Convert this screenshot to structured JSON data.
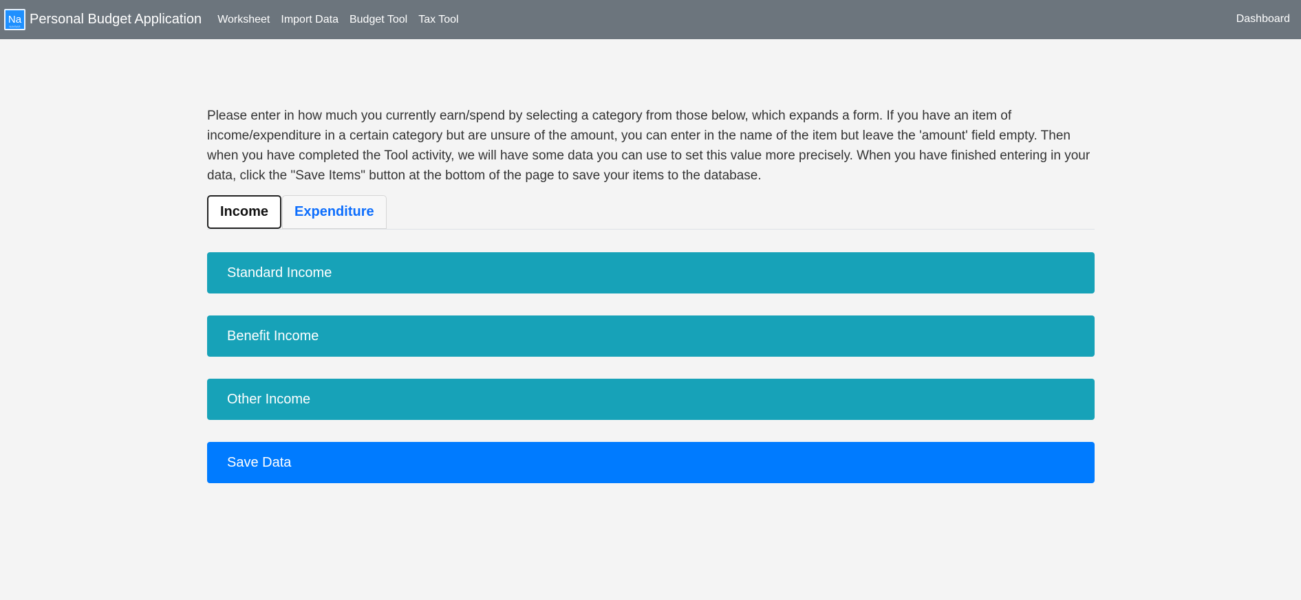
{
  "navbar": {
    "logo_text": "Na",
    "logo_subtext": "NAVBAR",
    "brand": "Personal Budget Application",
    "links": [
      "Worksheet",
      "Import Data",
      "Budget Tool",
      "Tax Tool"
    ],
    "right_link": "Dashboard",
    "bg_color": "#6c757d"
  },
  "main": {
    "intro": "Please enter in how much you currently earn/spend by selecting a category from those below, which expands a form. If you have an item of income/expenditure in a certain category but are unsure of the amount, you can enter in the name of the item but leave the 'amount' field empty. Then when you have completed the Tool activity, we will have some data you can use to set this value more precisely. When you have finished entering in your data, click the \"Save Items\" button at the bottom of the page to save your items to the database.",
    "tabs": [
      {
        "label": "Income",
        "active": true
      },
      {
        "label": "Expenditure",
        "active": false
      }
    ],
    "panels": [
      {
        "label": "Standard Income",
        "color": "#17a2b8"
      },
      {
        "label": "Benefit Income",
        "color": "#17a2b8"
      },
      {
        "label": "Other Income",
        "color": "#17a2b8"
      }
    ],
    "save_button": {
      "label": "Save Data",
      "color": "#007bff"
    }
  }
}
